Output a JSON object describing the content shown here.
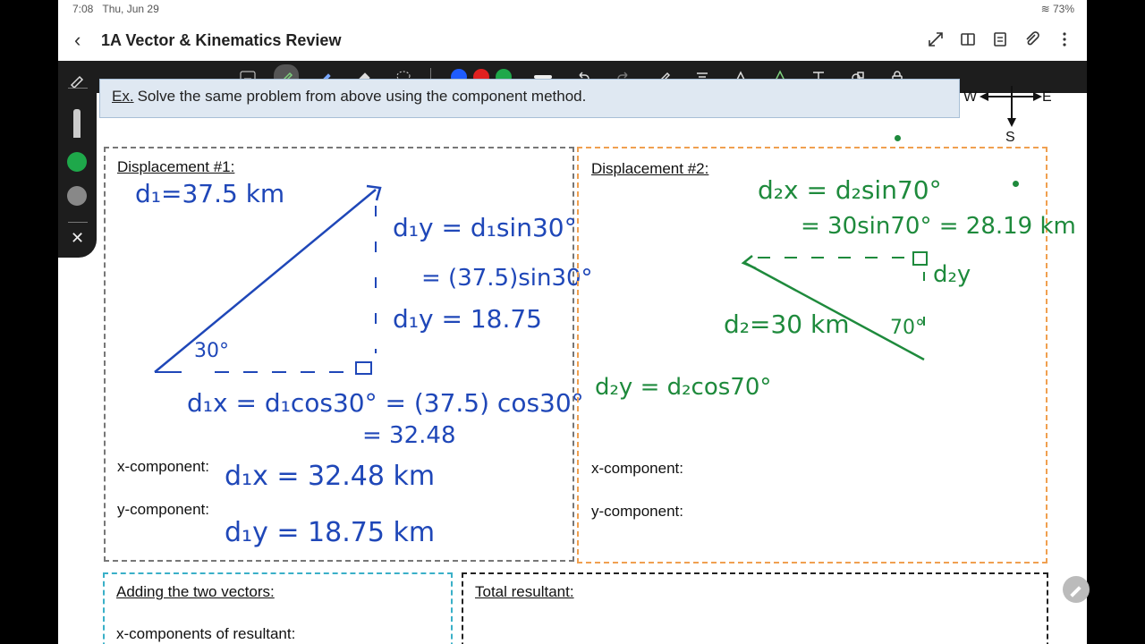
{
  "status": {
    "time": "7:08",
    "date": "Thu, Jun 29",
    "battery": "73%"
  },
  "header": {
    "back_icon": "chevron-left-icon",
    "title": "1A Vector & Kinematics Review"
  },
  "ex": {
    "prefix": "Ex.",
    "text": "Solve the same problem from above using the component method."
  },
  "compass": {
    "w": "W",
    "e": "E",
    "s": "S"
  },
  "box1": {
    "title": "Displacement #1:",
    "xcomp_label": "x-component:",
    "ycomp_label": "y-component:",
    "hw": {
      "d1": "d₁=37.5 km",
      "angle": "30°",
      "d1y_eq": "d₁y = d₁sin30°",
      "d1y_sub": "= (37.5)sin30°",
      "d1y_val": "d₁y = 18.75",
      "d1x_eq": "d₁x = d₁cos30° = (37.5) cos30°",
      "d1x_val": "= 32.48",
      "xcomp": "d₁x = 32.48 km",
      "ycomp": "d₁y = 18.75 km"
    }
  },
  "box2": {
    "title": "Displacement #2:",
    "xcomp_label": "x-component:",
    "ycomp_label": "y-component:",
    "hw": {
      "d2x_eq": "d₂x = d₂sin70°",
      "d2x_val": "= 30sin70° = 28.19 km",
      "d2y_label": "d₂y",
      "d2": "d₂=30 km",
      "angle": "70°",
      "d2y_eq": "d₂y = d₂cos70°"
    }
  },
  "box3": {
    "title": "Adding the two vectors:",
    "xres_label": "x-components of resultant:"
  },
  "box4": {
    "title": "Total resultant:"
  }
}
